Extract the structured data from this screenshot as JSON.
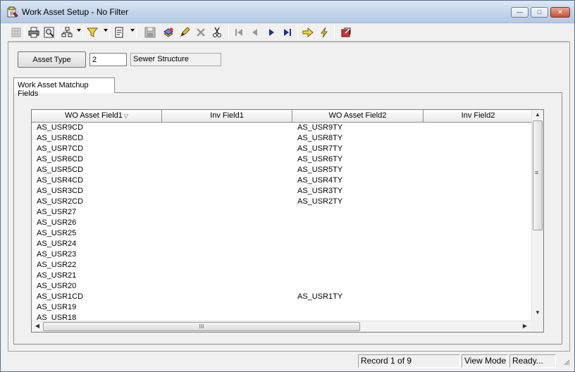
{
  "window": {
    "title": "Work Asset Setup - No Filter",
    "minimize_glyph": "—",
    "maximize_glyph": "□",
    "close_glyph": "✕"
  },
  "toolbar": {
    "icons": [
      "grid-view-icon",
      "print-icon",
      "print-preview-icon",
      "hierarchy-icon",
      "filter-icon",
      "report-icon",
      "save-icon",
      "new-record-icon",
      "edit-icon",
      "delete-icon",
      "cut-icon",
      "first-record-icon",
      "previous-record-icon",
      "next-record-icon",
      "last-record-icon",
      "goto-icon",
      "lightning-icon",
      "exit-icon"
    ]
  },
  "asset": {
    "type_button_label": "Asset Type",
    "code_value": "2",
    "description": "Sewer Structure"
  },
  "tab": {
    "label": "Work Asset Matchup Fields"
  },
  "grid": {
    "columns": [
      "WO Asset Field1",
      "Inv Field1",
      "WO Asset Field2",
      "Inv Field2"
    ],
    "sort_glyph": "▽",
    "rows": [
      [
        "AS_USR9CD",
        "",
        "AS_USR9TY",
        ""
      ],
      [
        "AS_USR8CD",
        "",
        "AS_USR8TY",
        ""
      ],
      [
        "AS_USR7CD",
        "",
        "AS_USR7TY",
        ""
      ],
      [
        "AS_USR6CD",
        "",
        "AS_USR6TY",
        ""
      ],
      [
        "AS_USR5CD",
        "",
        "AS_USR5TY",
        ""
      ],
      [
        "AS_USR4CD",
        "",
        "AS_USR4TY",
        ""
      ],
      [
        "AS_USR3CD",
        "",
        "AS_USR3TY",
        ""
      ],
      [
        "AS_USR2CD",
        "",
        "AS_USR2TY",
        ""
      ],
      [
        "AS_USR27",
        "",
        "",
        ""
      ],
      [
        "AS_USR26",
        "",
        "",
        ""
      ],
      [
        "AS_USR25",
        "",
        "",
        ""
      ],
      [
        "AS_USR24",
        "",
        "",
        ""
      ],
      [
        "AS_USR23",
        "",
        "",
        ""
      ],
      [
        "AS_USR22",
        "",
        "",
        ""
      ],
      [
        "AS_USR21",
        "",
        "",
        ""
      ],
      [
        "AS_USR20",
        "",
        "",
        ""
      ],
      [
        "AS_USR1CD",
        "",
        "AS_USR1TY",
        ""
      ],
      [
        "AS_USR19",
        "",
        "",
        ""
      ],
      [
        "AS_USR18",
        "",
        "",
        ""
      ]
    ],
    "hscroll_grip": "III",
    "vscroll_grip": "≡"
  },
  "status": {
    "record": "Record 1 of 9",
    "mode": "View Mode",
    "state": "Ready..."
  }
}
